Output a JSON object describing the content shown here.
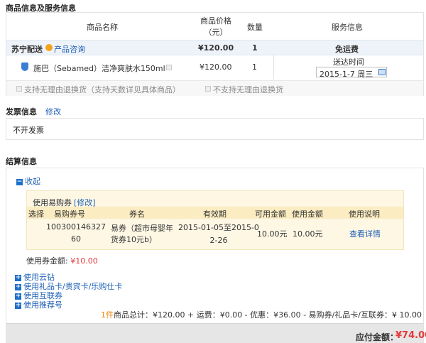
{
  "goods": {
    "title": "商品信息及服务信息",
    "headers": {
      "name": "商品名称",
      "price_line1": "商品价格",
      "price_line2": "（元）",
      "qty": "数量",
      "service": "服务信息"
    },
    "store": {
      "name": "苏宁配送",
      "link": "产品咨询",
      "price": "¥120.00",
      "qty": "1",
      "service": "免运费"
    },
    "item": {
      "name": "施巴（Sebamed）洁净爽肤水150ml",
      "price": "¥120.00",
      "qty": "1",
      "delivery_label": "送达时间",
      "delivery_date": "2015-1-7 周三"
    },
    "return_yes": "支持无理由退换货（支持天数详见具体商品）",
    "return_no": "不支持无理由退换货"
  },
  "invoice": {
    "title": "发票信息",
    "edit": "修改",
    "value": "不开发票"
  },
  "settle": {
    "title": "结算信息",
    "collapse": "收起",
    "coupon": {
      "label": "使用易购券",
      "edit": "[修改]",
      "headers": [
        "选择",
        "易购券号",
        "券名",
        "有效期",
        "可用金额",
        "使用金额",
        "使用说明"
      ],
      "row": {
        "number_line1": "100300146327",
        "number_line2": "60",
        "name_line1": "易券（超市母婴年",
        "name_line2": "货券10元b）",
        "valid_line1": "2015-01-05至2015-0",
        "valid_line2": "2-26",
        "available": "10.00元",
        "used": "10.00元",
        "detail": "查看详情"
      },
      "amount_label": "使用券金额:",
      "amount_value": "¥10.00"
    },
    "options": [
      "使用云钻",
      "使用礼品卡/贵宾卡/乐购仕卡",
      "使用互联券",
      "使用推荐号"
    ],
    "summary": {
      "count": "1件",
      "text": "商品总计：¥120.00 + 运费：¥0.00 - 优惠：¥36.00 - 易购券/礼品卡/互联券：¥ 10.00"
    },
    "total_label": "应付金额：",
    "total_value": "¥74.00"
  }
}
